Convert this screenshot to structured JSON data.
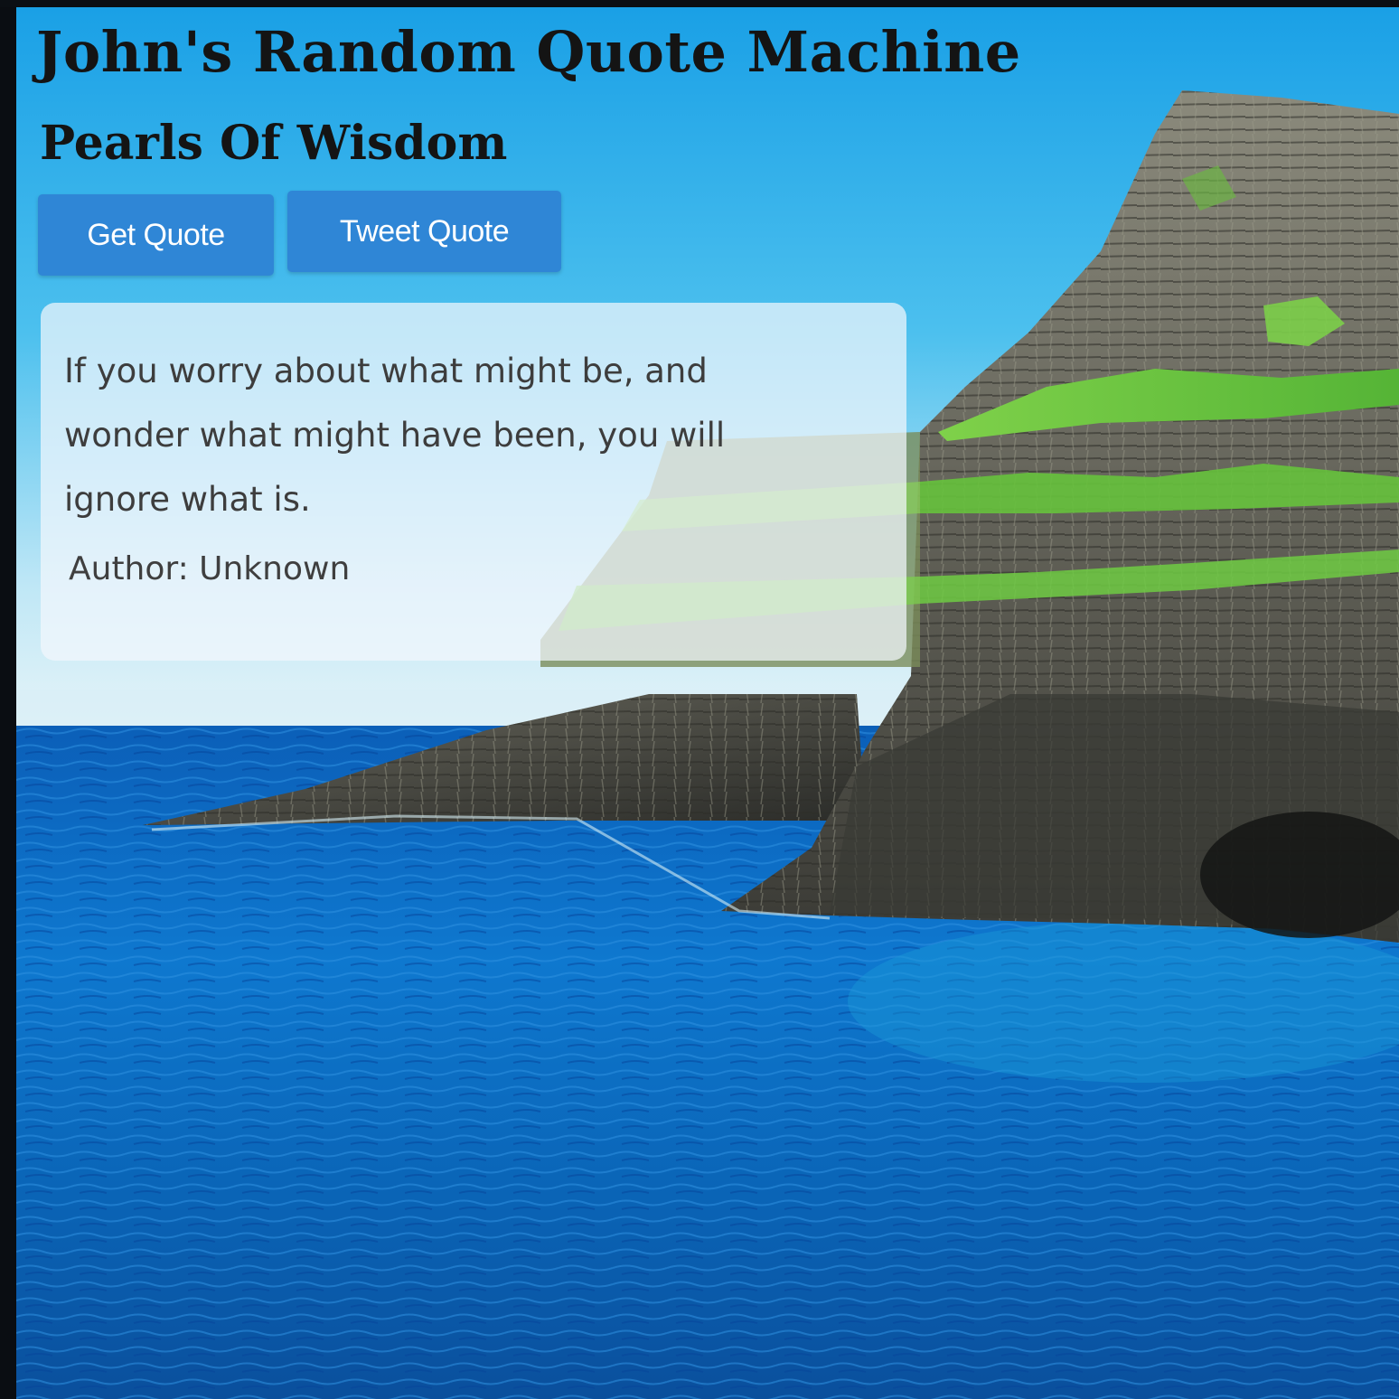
{
  "header": {
    "title": "John's Random Quote Machine",
    "subtitle": "Pearls Of Wisdom"
  },
  "actions": {
    "get_quote_label": "Get Quote",
    "tweet_quote_label": "Tweet Quote"
  },
  "quote": {
    "text": "If you worry about what might be, and wonder what might have been, you will ignore what is.",
    "author_line": "Author: Unknown"
  },
  "theme": {
    "button_color": "#2f86d6",
    "title_color": "#141414",
    "card_background": "rgba(242,246,252,0.72)"
  },
  "background": {
    "subject": "sea-cliff-landscape"
  }
}
